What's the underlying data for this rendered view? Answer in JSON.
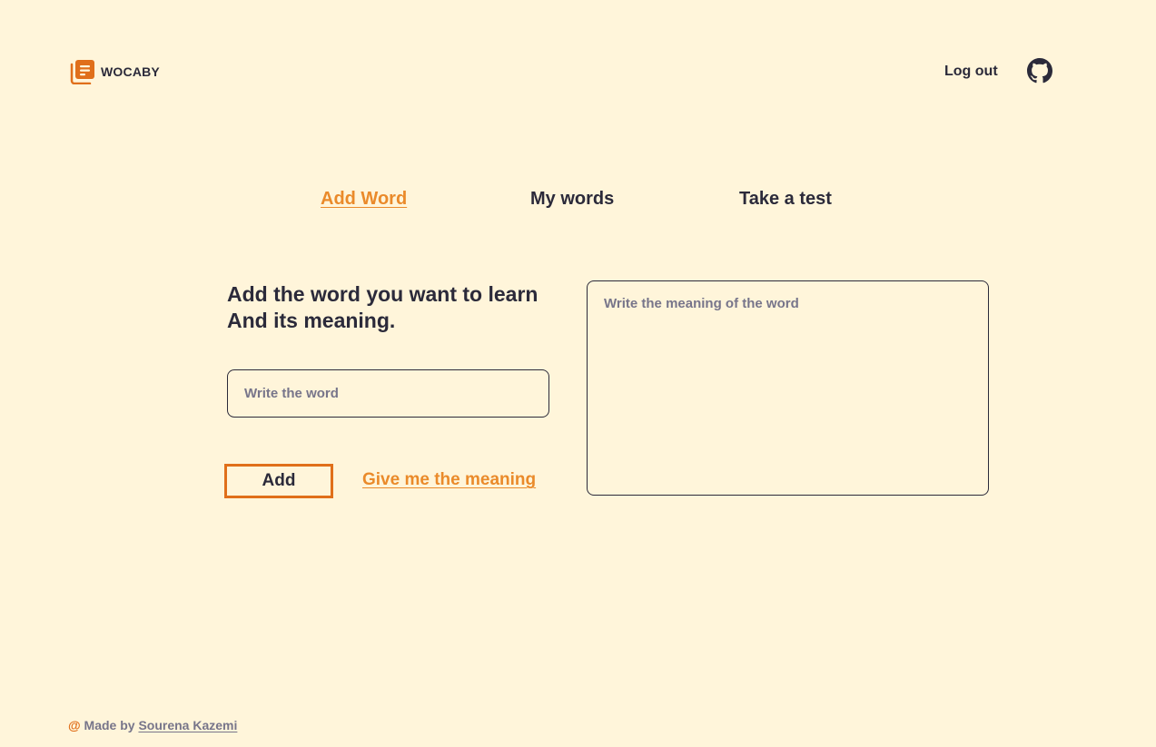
{
  "app": {
    "name": "WOCABY"
  },
  "header": {
    "logout_label": "Log out"
  },
  "tabs": [
    {
      "label": "Add Word",
      "active": true
    },
    {
      "label": "My words",
      "active": false
    },
    {
      "label": "Take a test",
      "active": false
    }
  ],
  "form": {
    "heading_line1": "Add the word you want to learn",
    "heading_line2": "And its meaning.",
    "word_placeholder": "Write the word",
    "word_value": "",
    "add_label": "Add",
    "meaning_link": "Give me the meaning",
    "meaning_placeholder": "Write the meaning of the word",
    "meaning_value": ""
  },
  "footer": {
    "at_symbol": "@",
    "made_by": "Made by",
    "author": "Sourena Kazemi"
  },
  "icons": {
    "logo": "notebook-icon",
    "github": "github-icon"
  },
  "colors": {
    "background": "#fff5da",
    "accent": "#ea8a2a",
    "accent_dark": "#e06f1a",
    "text": "#2b2a3a",
    "muted": "#77758a"
  }
}
